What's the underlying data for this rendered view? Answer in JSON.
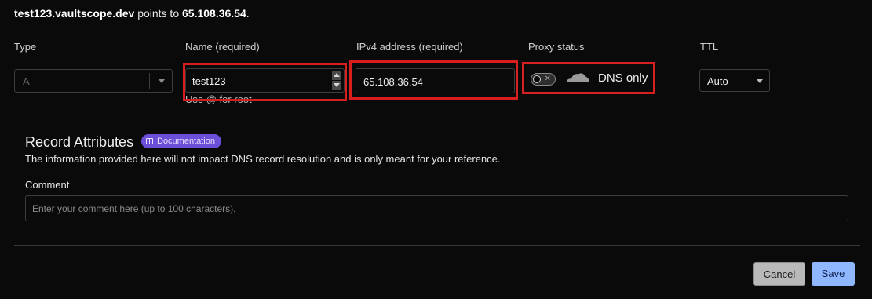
{
  "header": {
    "domain": "test123.vaultscope.dev",
    "points_to_text": "points to",
    "ip": "65.108.36.54",
    "period": "."
  },
  "labels": {
    "type": "Type",
    "name": "Name (required)",
    "ipv4": "IPv4 address (required)",
    "proxy": "Proxy status",
    "ttl": "TTL"
  },
  "fields": {
    "type_value": "A",
    "name_value": "test123",
    "name_hint": "Use @ for root",
    "ipv4_value": "65.108.36.54",
    "proxy_label": "DNS only",
    "ttl_value": "Auto"
  },
  "record_attributes": {
    "title": "Record Attributes",
    "badge": "Documentation",
    "description": "The information provided here will not impact DNS record resolution and is only meant for your reference.",
    "comment_label": "Comment",
    "comment_placeholder": "Enter your comment here (up to 100 characters)."
  },
  "buttons": {
    "cancel": "Cancel",
    "save": "Save"
  },
  "colors": {
    "highlight": "#d81f1f",
    "save_button": "#8fb7ff",
    "badge": "#6b4fd8"
  },
  "icons": {
    "proxy_toggle": "toggle-off-icon",
    "cloud": "cloud-icon",
    "book": "book-icon"
  }
}
